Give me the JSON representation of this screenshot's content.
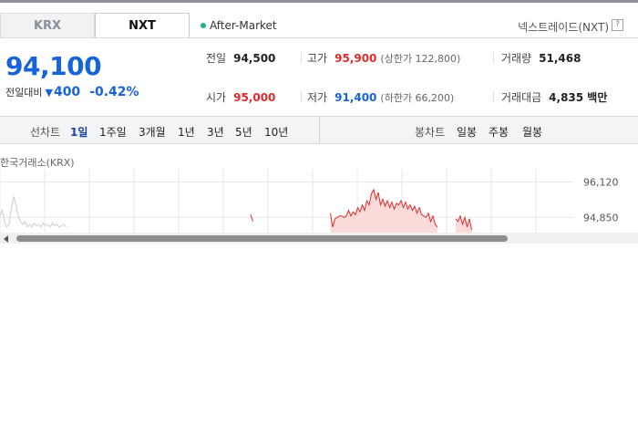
{
  "tabs": [
    {
      "label": "KRX",
      "active": false
    },
    {
      "label": "NXT",
      "active": true
    }
  ],
  "session_label": "After-Market",
  "venue_label": "넥스트레이드(NXT)",
  "help_label": "?",
  "price": "94,100",
  "change": {
    "label": "전일대비",
    "arrow": "▼",
    "amount": "400",
    "percent": "-0.42%"
  },
  "stats": {
    "prev_close": {
      "label": "전일",
      "value": "94,500"
    },
    "high": {
      "label": "고가",
      "value": "95,900",
      "limit": "(상한가 122,800)"
    },
    "volume": {
      "label": "거래량",
      "value": "51,468"
    },
    "open": {
      "label": "시가",
      "value": "95,000"
    },
    "low": {
      "label": "저가",
      "value": "91,400",
      "limit": "(하한가 66,200)"
    },
    "turnover": {
      "label": "거래대금",
      "value": "4,835 백만"
    }
  },
  "line_chart": {
    "label": "선차트",
    "options": [
      "1일",
      "1주일",
      "3개월",
      "1년",
      "3년",
      "5년",
      "10년"
    ],
    "selected": "1일"
  },
  "candle_chart": {
    "label": "봉차트",
    "options": [
      "일봉",
      "주봉",
      "월봉"
    ]
  },
  "chart_source": "한국거래소(KRX)",
  "colors": {
    "up": "#e32a2a",
    "down": "#1763d9",
    "grid": "#e6e7ea",
    "area": "#fbdada",
    "krx_line": "#c9cbd0"
  },
  "chart_data": {
    "type": "line",
    "y_ticks": [
      "96,120",
      "94,850"
    ],
    "y_tick_values": [
      96120,
      94850
    ],
    "ylim": [
      94300,
      96600
    ],
    "grid": true,
    "series": [
      {
        "points": [
          [
            0,
            94900
          ],
          [
            1,
            95100
          ],
          [
            2,
            94700
          ],
          [
            3,
            94500
          ],
          [
            4,
            94600
          ],
          [
            5,
            95200
          ],
          [
            6,
            95600
          ],
          [
            7,
            95300
          ],
          [
            8,
            94900
          ],
          [
            9,
            94700
          ],
          [
            10,
            94600
          ],
          [
            11,
            94700
          ],
          [
            12,
            94500
          ],
          [
            13,
            94600
          ],
          [
            14,
            94500
          ],
          [
            15,
            94650
          ],
          [
            16,
            94550
          ],
          [
            17,
            94600
          ],
          [
            18,
            94500
          ],
          [
            19,
            94650
          ],
          [
            20,
            94550
          ],
          [
            21,
            94600
          ],
          [
            22,
            94500
          ],
          [
            23,
            94650
          ],
          [
            24,
            94550
          ],
          [
            25,
            94600
          ],
          [
            26,
            94500
          ],
          [
            27,
            94550
          ],
          [
            28,
            94600
          ],
          [
            29,
            94500
          ]
        ]
      },
      {
        "points": [
          [
            110,
            94950
          ],
          [
            111,
            94700
          ]
        ]
      },
      {
        "points": [
          [
            145,
            95000
          ],
          [
            146,
            94500
          ],
          [
            147,
            94800
          ],
          [
            148,
            94850
          ],
          [
            149,
            94900
          ],
          [
            150,
            94900
          ],
          [
            151,
            94850
          ],
          [
            152,
            94900
          ],
          [
            153,
            95100
          ],
          [
            154,
            94900
          ],
          [
            155,
            95050
          ],
          [
            156,
            94950
          ],
          [
            157,
            95200
          ],
          [
            158,
            95050
          ],
          [
            159,
            95300
          ],
          [
            160,
            95100
          ],
          [
            161,
            95450
          ],
          [
            162,
            95300
          ],
          [
            163,
            95700
          ],
          [
            164,
            95850
          ],
          [
            165,
            95500
          ],
          [
            166,
            95750
          ],
          [
            167,
            95300
          ],
          [
            168,
            95500
          ],
          [
            169,
            95250
          ],
          [
            170,
            95450
          ],
          [
            171,
            95200
          ],
          [
            172,
            95400
          ],
          [
            173,
            95150
          ],
          [
            174,
            95350
          ],
          [
            175,
            95300
          ],
          [
            176,
            95450
          ],
          [
            177,
            95200
          ],
          [
            178,
            95400
          ],
          [
            179,
            95150
          ],
          [
            180,
            95300
          ],
          [
            181,
            95100
          ],
          [
            182,
            95250
          ],
          [
            183,
            95000
          ],
          [
            184,
            95200
          ],
          [
            185,
            94950
          ],
          [
            186,
            94900
          ],
          [
            187,
            94850
          ],
          [
            188,
            95000
          ],
          [
            189,
            94700
          ],
          [
            190,
            94900
          ],
          [
            191,
            94600
          ],
          [
            192,
            94500
          ]
        ]
      },
      {
        "points": [
          [
            200,
            94800
          ],
          [
            201,
            94700
          ],
          [
            202,
            94900
          ],
          [
            203,
            94600
          ],
          [
            204,
            94850
          ],
          [
            205,
            94500
          ],
          [
            206,
            94800
          ],
          [
            207,
            94400
          ]
        ]
      }
    ],
    "x_max": 240
  },
  "scrollbar": {
    "thumb_fraction": 0.79
  }
}
